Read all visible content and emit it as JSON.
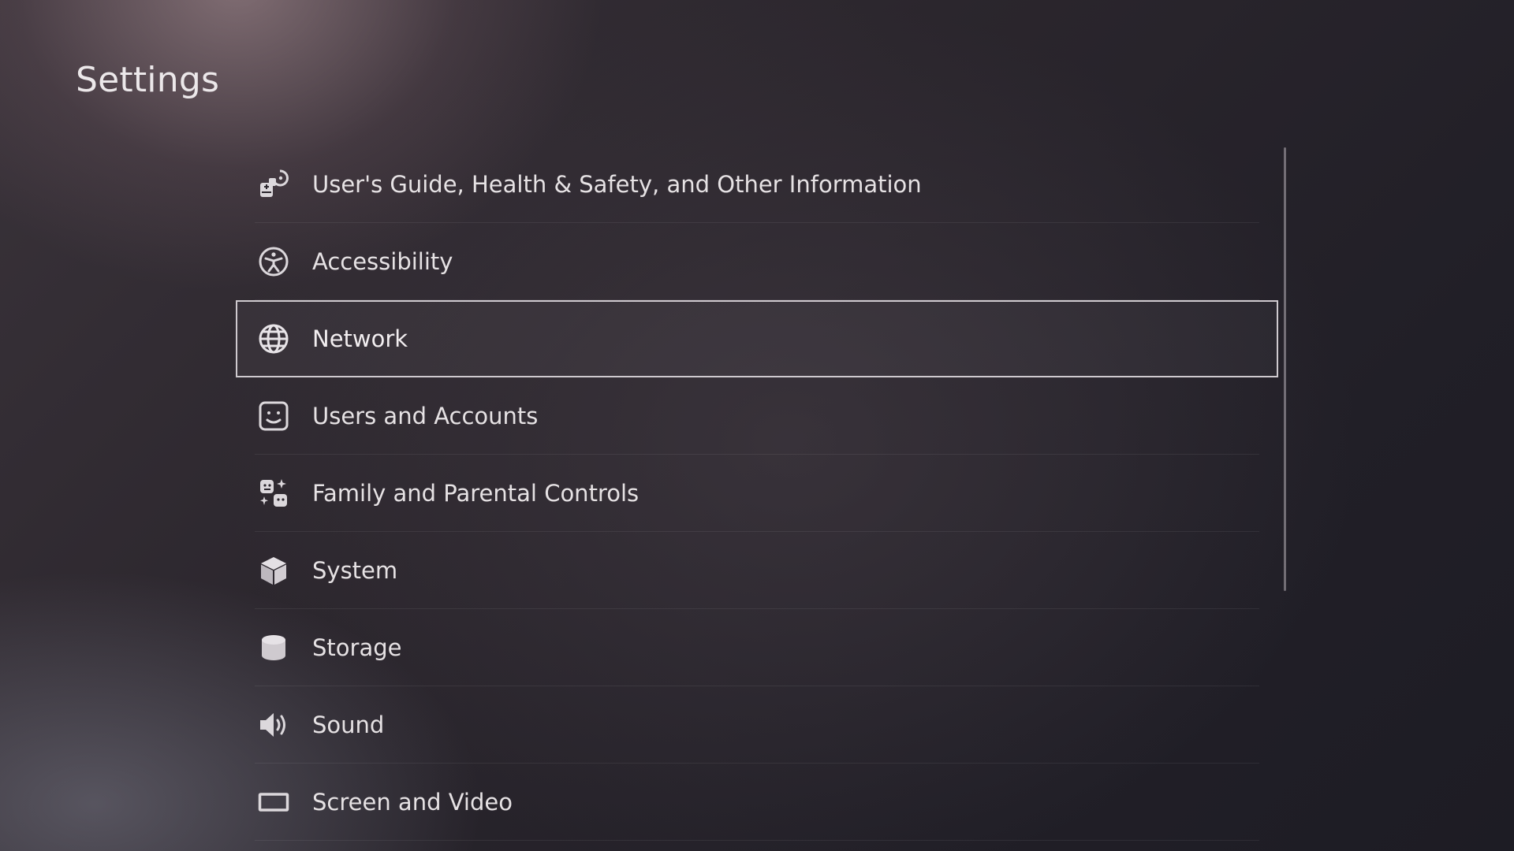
{
  "page": {
    "title": "Settings"
  },
  "menu": {
    "selected_index": 2,
    "items": [
      {
        "label": "User's Guide, Health & Safety, and Other Information",
        "icon": "users-guide-icon"
      },
      {
        "label": "Accessibility",
        "icon": "accessibility-icon"
      },
      {
        "label": "Network",
        "icon": "globe-icon"
      },
      {
        "label": "Users and Accounts",
        "icon": "user-face-icon"
      },
      {
        "label": "Family and Parental Controls",
        "icon": "family-icon"
      },
      {
        "label": "System",
        "icon": "cube-icon"
      },
      {
        "label": "Storage",
        "icon": "storage-icon"
      },
      {
        "label": "Sound",
        "icon": "speaker-icon"
      },
      {
        "label": "Screen and Video",
        "icon": "screen-icon"
      }
    ]
  },
  "colors": {
    "text": "#e6e2e4",
    "selection_border": "#cfcacf",
    "background_dark": "#1d1c24"
  }
}
